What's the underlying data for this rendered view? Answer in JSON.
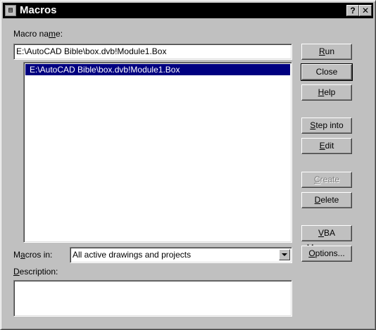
{
  "window": {
    "title": "Macros",
    "help_glyph": "?",
    "close_glyph": "✕",
    "icon": "app-document-icon"
  },
  "macro_name": {
    "label_pre": "Macro na",
    "label_accel": "m",
    "label_post": "e:",
    "value": "E:\\AutoCAD Bible\\box.dvb!Module1.Box"
  },
  "macro_list": {
    "items": [
      "E:\\AutoCAD Bible\\box.dvb!Module1.Box"
    ],
    "selected_index": 0
  },
  "buttons": {
    "run": {
      "pre": "",
      "accel": "R",
      "post": "un",
      "enabled": true
    },
    "close": {
      "pre": "Close",
      "accel": "",
      "post": "",
      "enabled": true,
      "default": true
    },
    "help": {
      "pre": "",
      "accel": "H",
      "post": "elp",
      "enabled": true
    },
    "step_into": {
      "pre": "",
      "accel": "S",
      "post": "tep into",
      "enabled": true
    },
    "edit": {
      "pre": "",
      "accel": "E",
      "post": "dit",
      "enabled": true
    },
    "create": {
      "pre": "",
      "accel": "C",
      "post": "reate",
      "enabled": false
    },
    "delete": {
      "pre": "",
      "accel": "D",
      "post": "elete",
      "enabled": true
    },
    "vba_manager": {
      "pre": "",
      "accel": "V",
      "post": "BA Manager...",
      "enabled": true
    },
    "options": {
      "pre": "",
      "accel": "O",
      "post": "ptions...",
      "enabled": true
    }
  },
  "macros_in": {
    "label_pre": "M",
    "label_accel": "a",
    "label_post": "cros in:",
    "value": "All active drawings and projects"
  },
  "description": {
    "label_pre": "",
    "label_accel": "D",
    "label_post": "escription:",
    "value": ""
  },
  "colors": {
    "face": "#c0c0c0",
    "titlebar": "#000000",
    "selection": "#000080",
    "disabled_text": "#808080"
  }
}
